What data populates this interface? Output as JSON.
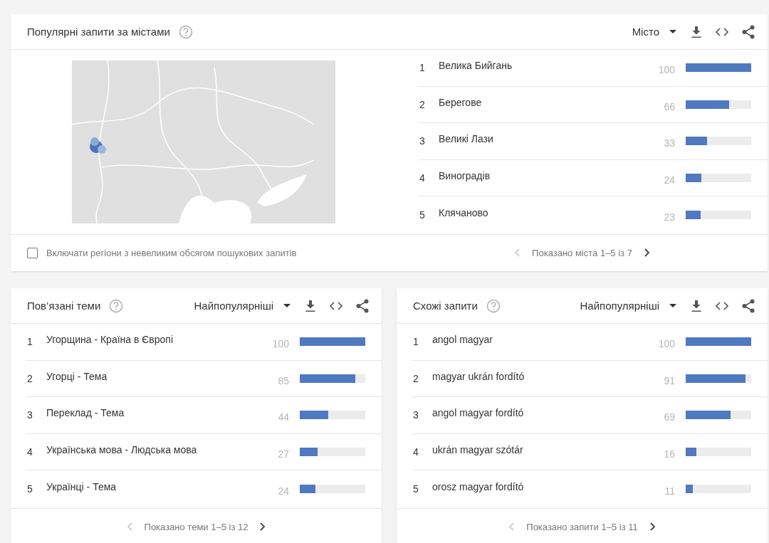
{
  "cities": {
    "title": "Популярні запити за містами",
    "dropdown": "Місто",
    "rows": [
      {
        "rank": "1",
        "name": "Велика Бийгань",
        "value": "100",
        "level": 1.0
      },
      {
        "rank": "2",
        "name": "Берегове",
        "value": "66",
        "level": 0.66
      },
      {
        "rank": "3",
        "name": "Великі Лази",
        "value": "33",
        "level": 0.33
      },
      {
        "rank": "4",
        "name": "Виноградів",
        "value": "24",
        "level": 0.24
      },
      {
        "rank": "5",
        "name": "Клячаново",
        "value": "23",
        "level": 0.23
      }
    ],
    "include_low_volume": {
      "label": "Включати регіони з невеликим обсягом пошукових запитів",
      "checked": false
    },
    "pager": {
      "text": "Показано міста 1–5 із 7",
      "prev_disabled": true,
      "next_disabled": false
    }
  },
  "related_topics": {
    "title": "Пов’язані теми",
    "dropdown": "Найпопулярніші",
    "rows": [
      {
        "rank": "1",
        "name": "Угорщина - Країна в Європі",
        "value": "100",
        "level": 1.0
      },
      {
        "rank": "2",
        "name": "Угорці - Тема",
        "value": "85",
        "level": 0.85
      },
      {
        "rank": "3",
        "name": "Переклад - Тема",
        "value": "44",
        "level": 0.44
      },
      {
        "rank": "4",
        "name": "Українська мова - Людська мова",
        "value": "27",
        "level": 0.27
      },
      {
        "rank": "5",
        "name": "Українці - Тема",
        "value": "24",
        "level": 0.24
      }
    ],
    "pager": {
      "text": "Показано теми 1–5 із 12",
      "prev_disabled": true,
      "next_disabled": false
    }
  },
  "related_queries": {
    "title": "Схожі запити",
    "dropdown": "Найпопулярніші",
    "rows": [
      {
        "rank": "1",
        "name": "angol magyar",
        "value": "100",
        "level": 1.0
      },
      {
        "rank": "2",
        "name": "magyar ukrán fordító",
        "value": "91",
        "level": 0.91
      },
      {
        "rank": "3",
        "name": "angol magyar fordító",
        "value": "69",
        "level": 0.69
      },
      {
        "rank": "4",
        "name": "ukrán magyar szótár",
        "value": "16",
        "level": 0.16
      },
      {
        "rank": "5",
        "name": "orosz magyar fordító",
        "value": "11",
        "level": 0.11
      }
    ],
    "pager": {
      "text": "Показано запити 1–5 із 11",
      "prev_disabled": true,
      "next_disabled": false
    }
  }
}
